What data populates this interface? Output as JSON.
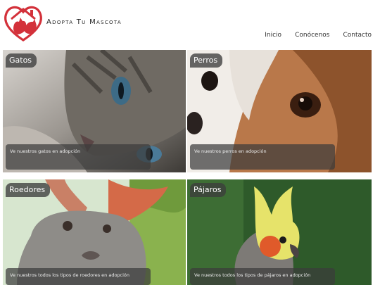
{
  "brand": {
    "name": "Adopta Tu Mascota"
  },
  "nav": {
    "items": [
      "Inicio",
      "Conócenos",
      "Contacto"
    ]
  },
  "cards": [
    {
      "tag": "Gatos",
      "caption": "Ve nuestros gatos en adopción",
      "icon": "cat-photo"
    },
    {
      "tag": "Perros",
      "caption": "Ve nuestros perros en adopción",
      "icon": "dog-photo"
    },
    {
      "tag": "Roedores",
      "caption": "Ve nuestros todos los tipos de roedores en adopción",
      "icon": "rabbit-photo"
    },
    {
      "tag": "Pájaros",
      "caption": "Ve nuestros todos los tipos de pájaros en adopción",
      "icon": "bird-photo"
    }
  ],
  "colors": {
    "brand_red": "#d3313a",
    "tag_bg": "#3c3c3c"
  }
}
